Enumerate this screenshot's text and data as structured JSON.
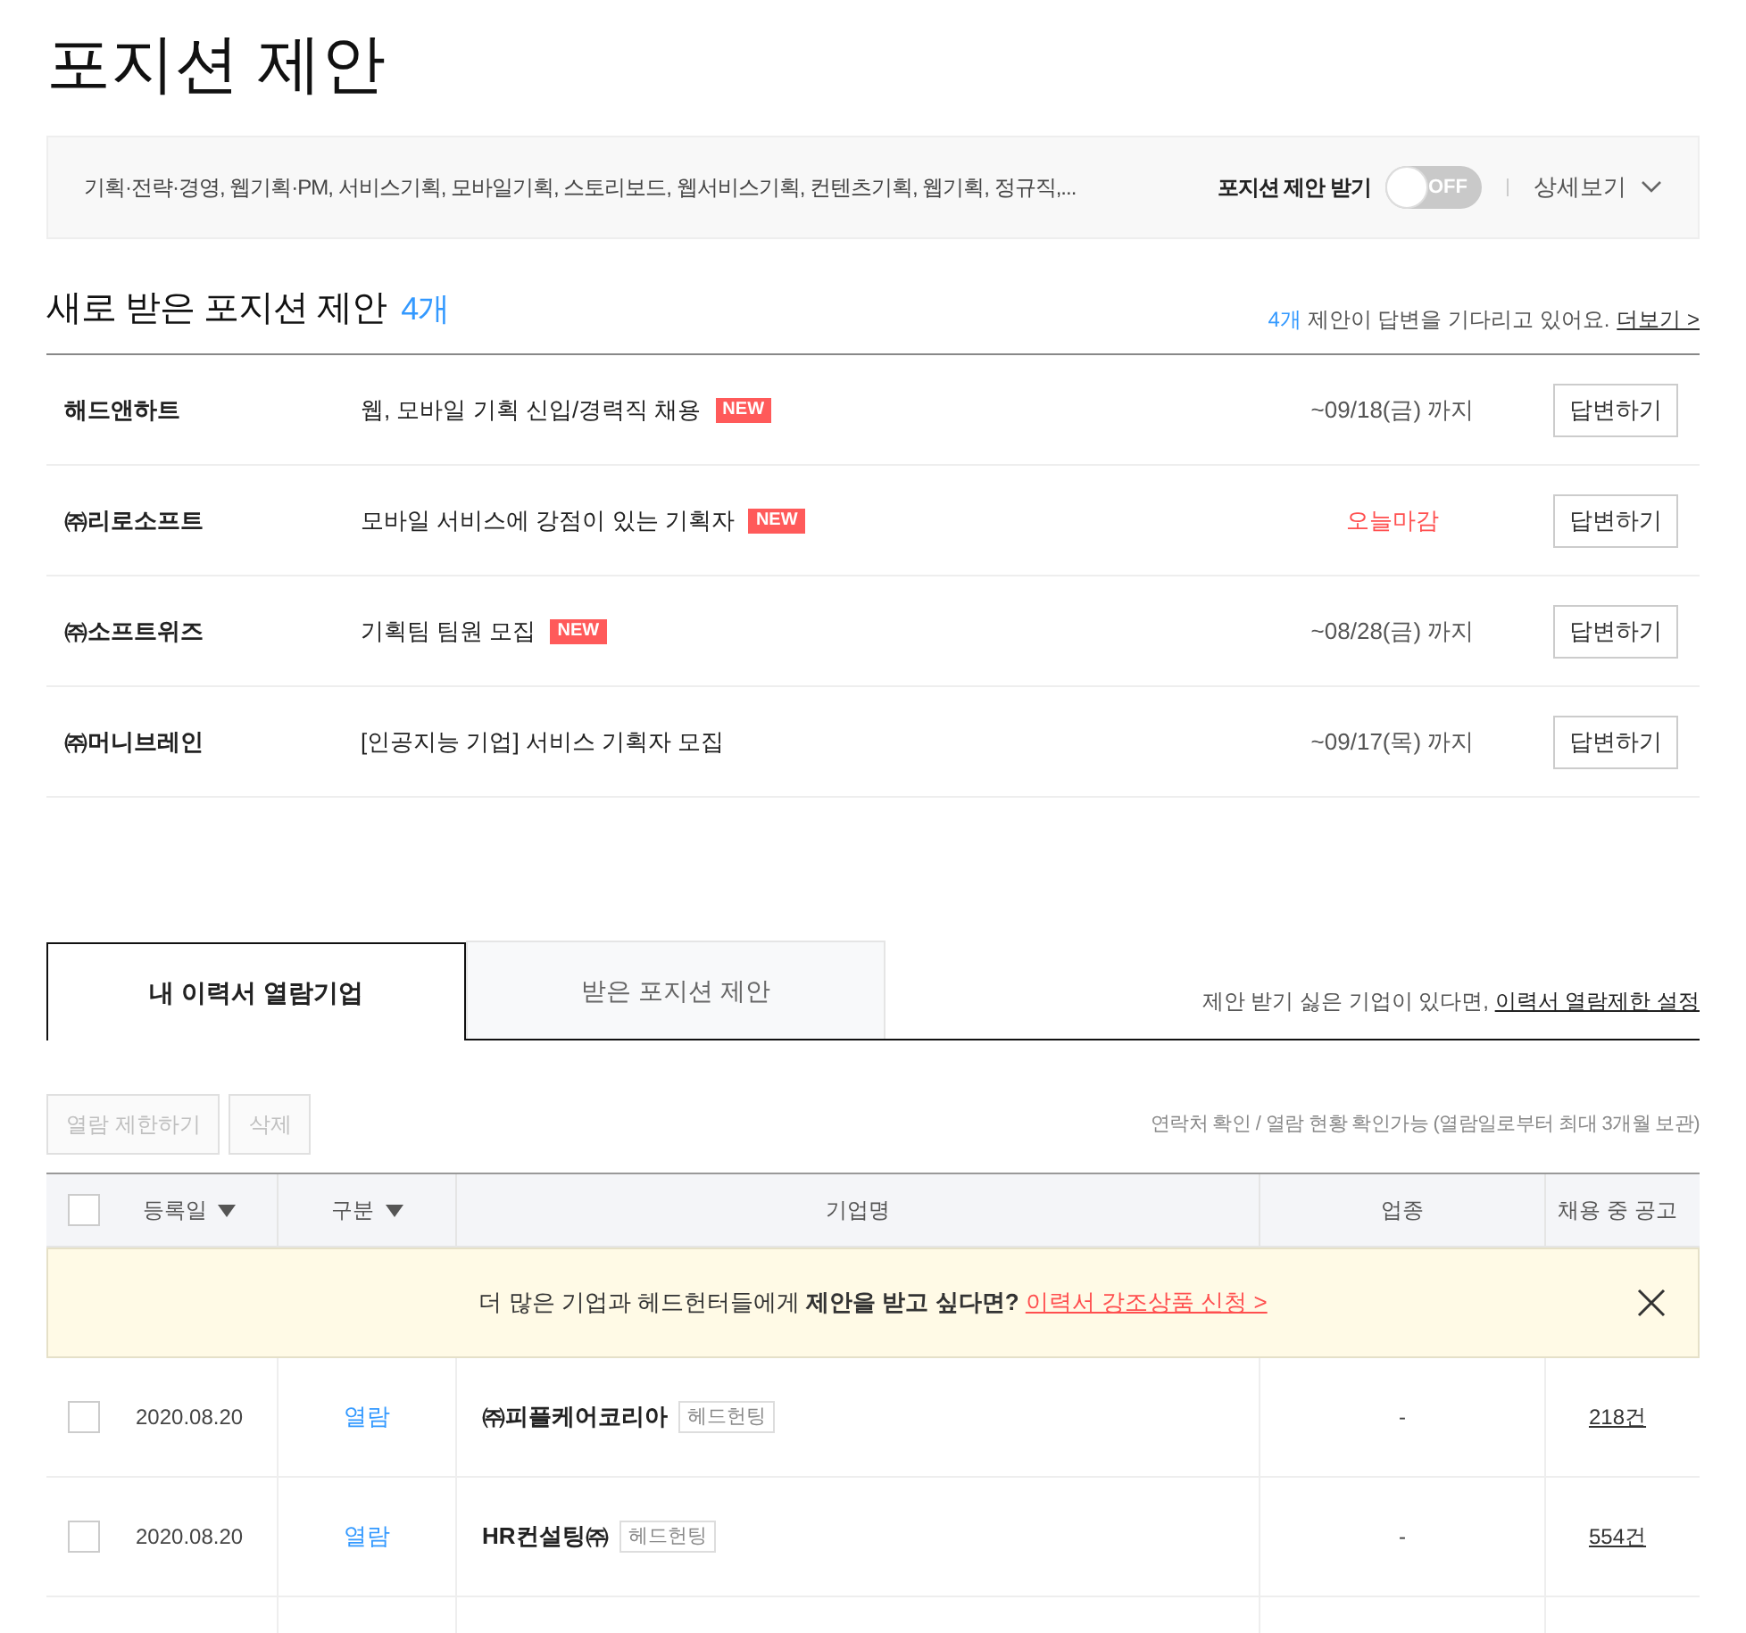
{
  "page_title": "포지션 제안",
  "filter_bar": {
    "keywords": "기획·전략·경영, 웹기획·PM,  서비스기획, 모바일기획, 스토리보드, 웹서비스기획, 컨텐츠기획, 웹기획,  정규직,...",
    "toggle_label": "포지션 제안 받기",
    "toggle": {
      "on": false,
      "label": "OFF"
    },
    "detail_link": "상세보기",
    "expanded": false
  },
  "proposals": {
    "title": "새로 받은 포지션 제안",
    "count": "4개",
    "waiting_count": "4개",
    "waiting_text": " 제안이 답변을 기다리고 있어요.",
    "more_link": "더보기 >",
    "items": [
      {
        "company": "해드앤하트",
        "title": "웹, 모바일 기획 신입/경력직 채용",
        "badge": "NEW",
        "deadline": "~09/18(금) 까지",
        "urgent": false,
        "reply_button": "답변하기"
      },
      {
        "company": "㈜리로소프트",
        "title": "모바일 서비스에 강점이 있는 기획자",
        "badge": "NEW",
        "deadline": "오늘마감",
        "urgent": true,
        "reply_button": "답변하기"
      },
      {
        "company": "㈜소프트위즈",
        "title": "기획팀 팀원 모집",
        "badge": "NEW",
        "deadline": "~08/28(금) 까지",
        "urgent": false,
        "reply_button": "답변하기"
      },
      {
        "company": "㈜머니브레인",
        "title": "[인공지능 기업] 서비스 기획자 모집",
        "deadline": "~09/17(목) 까지",
        "urgent": false,
        "reply_button": "답변하기"
      }
    ]
  },
  "tabs": [
    {
      "label": "내 이력서 열람기업",
      "selected": true
    },
    {
      "label": "받은 포지션 제안",
      "selected": false
    }
  ],
  "tab_note": "제안 받기 싫은 기업이 있다면, ",
  "tab_note_link": "이력서 열람제한 설정",
  "actions": [
    {
      "label": "열람 제한하기",
      "disabled": true
    },
    {
      "label": "삭제",
      "disabled": true
    }
  ],
  "retention_note": "연락처 확인 / 열람 현황 확인가능 (열람일로부터 최대 3개월 보관)",
  "table": {
    "header_checked": false,
    "columns": [
      {
        "label": "등록일",
        "sortable": true
      },
      {
        "label": "구분",
        "sortable": true
      },
      {
        "label": "기업명",
        "sortable": false
      },
      {
        "label": "업종",
        "sortable": false
      },
      {
        "label": "채용 중 공고",
        "sortable": false
      }
    ],
    "banner": {
      "text": "더 많은 기업과 헤드헌터들에게 **제안을 받고 싶다면?** ",
      "link": "이력서 강조상품 신청 >"
    },
    "rows": [
      {
        "checked": false,
        "date": "2020.08.20",
        "type": "열람",
        "company": "㈜피플케어코리아",
        "tag": "헤드헌팅",
        "industry": "-",
        "jobs": "218건"
      },
      {
        "checked": false,
        "date": "2020.08.20",
        "type": "열람",
        "company": "HR컨설팅㈜",
        "tag": "헤드헌팅",
        "industry": "-",
        "jobs": "554건"
      }
    ]
  }
}
